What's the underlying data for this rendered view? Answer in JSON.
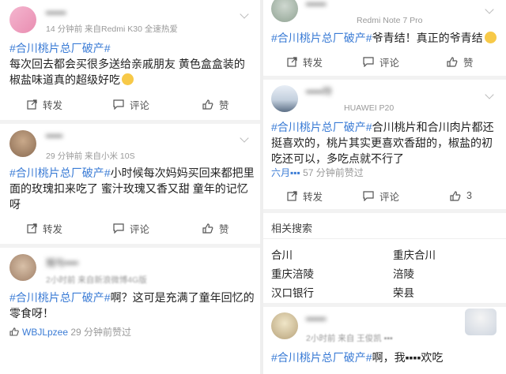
{
  "left": {
    "posts": [
      {
        "username": "▪▪▪▪▪▪",
        "meta": "14 分钟前  来自Redmi K30 全速热爱",
        "tag": "#合川桃片总厂破产#",
        "text": "每次回去都会买很多送给亲戚朋友 黄色盒盒装的椒盐味道真的超级好吃",
        "actions": {
          "repost": "转发",
          "comment": "评论",
          "like": "赞"
        }
      },
      {
        "username": "▪▪▪▪▪",
        "meta": "29 分钟前  来自小米 10S",
        "tag": "#合川桃片总厂破产#",
        "text": "小时候每次妈妈买回来都把里面的玫瑰扣来吃了 蜜汁玫瑰又香又甜 童年的记忆呀",
        "actions": {
          "repost": "转发",
          "comment": "评论",
          "like": "赞"
        }
      },
      {
        "username": "旭与▪▪▪▪",
        "meta": "2小时前  来自新浪微博4G版",
        "tag": "#合川桃片总厂破产#",
        "text": "啊？这可是充满了童年回忆的零食呀！",
        "comment": {
          "who": "WBJLpzee",
          "time": "29 分钟前赞过"
        }
      }
    ]
  },
  "right": {
    "posts": [
      {
        "username": "▪▪▪▪▪▪",
        "meta": "Redmi Note 7 Pro",
        "tag": "#合川桃片总厂破产#",
        "text": "爷青结！真正的爷青结",
        "actions": {
          "repost": "转发",
          "comment": "评论",
          "like": "赞"
        }
      },
      {
        "username": "▪▪▪▪▪玲",
        "meta": "HUAWEI P20",
        "tag": "#合川桃片总厂破产#",
        "text": "合川桃片和合川肉片都还挺喜欢的，桃片其实更喜欢香甜的，椒盐的初吃还可以，多吃点就不行了",
        "comment": {
          "who": "六月▪▪▪",
          "time": "57 分钟前赞过"
        },
        "actions": {
          "repost": "转发",
          "comment": "评论",
          "like": "3"
        }
      }
    ],
    "related": {
      "title": "相关搜索",
      "items": [
        "合川",
        "重庆合川",
        "重庆涪陵",
        "涪陵",
        "汉口银行",
        "荣县"
      ]
    },
    "last_post": {
      "meta": "2小时前  来自 王俊凯 ▪▪▪",
      "tag": "#合川桃片总厂破产#",
      "text": "啊，我▪▪▪▪欢吃"
    }
  },
  "colors": {
    "link": "#3a7bd5",
    "meta": "#999999",
    "separator": "#f2f2f2"
  }
}
